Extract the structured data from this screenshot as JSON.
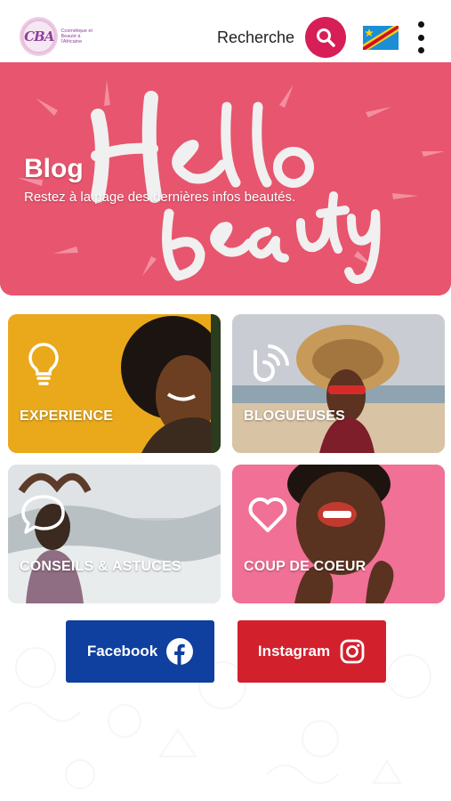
{
  "header": {
    "logo_mark": "CBA",
    "logo_text": "Cosmétique et Beauté à l'Africaine",
    "search_label": "Recherche",
    "search_icon": "search-icon",
    "flag_icon": "drc-flag-icon",
    "menu_icon": "kebab-menu-icon",
    "accent_color": "#d81e57"
  },
  "hero": {
    "art_text_1": "Hello",
    "art_text_2": "beauty",
    "title": "Blog",
    "subtitle": "Restez à la page des dernières infos beautés.",
    "background_color": "#e8556e"
  },
  "cards": [
    {
      "label": "EXPERIENCE",
      "icon": "lightbulb-icon",
      "color": "#e9a91b"
    },
    {
      "label": "BLOGUEUSES",
      "icon": "blog-rss-icon",
      "color": "#d9c8b5"
    },
    {
      "label": "CONSEILS & ASTUCES",
      "icon": "speech-bubble-icon",
      "color": "#c9ccd0"
    },
    {
      "label": "COUP DE COEUR",
      "icon": "heart-icon",
      "color": "#f07096"
    }
  ],
  "social": {
    "facebook": {
      "label": "Facebook",
      "icon": "facebook-icon",
      "color": "#0f3f9f"
    },
    "instagram": {
      "label": "Instagram",
      "icon": "instagram-icon",
      "color": "#d2202d"
    }
  }
}
